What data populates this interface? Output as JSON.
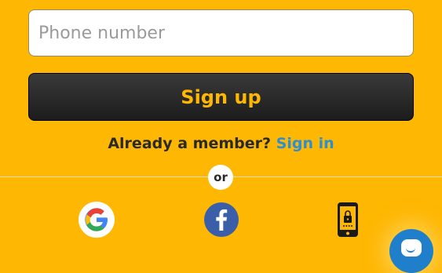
{
  "form": {
    "phone_placeholder": "Phone number",
    "signup_label": "Sign up"
  },
  "member": {
    "prompt": "Already a member?",
    "signin_label": "Sign in"
  },
  "divider": {
    "or_label": "or"
  },
  "social": [
    {
      "icon": "google-icon"
    },
    {
      "icon": "facebook-icon"
    },
    {
      "icon": "phone-lock-icon"
    }
  ],
  "chat": {
    "icon": "chat-bubble-icon"
  },
  "colors": {
    "background": "#FEB702",
    "button": "#1c1c1c",
    "button_text": "#FEB702",
    "link": "#2b8fd4",
    "chat": "#1f7fcb"
  }
}
